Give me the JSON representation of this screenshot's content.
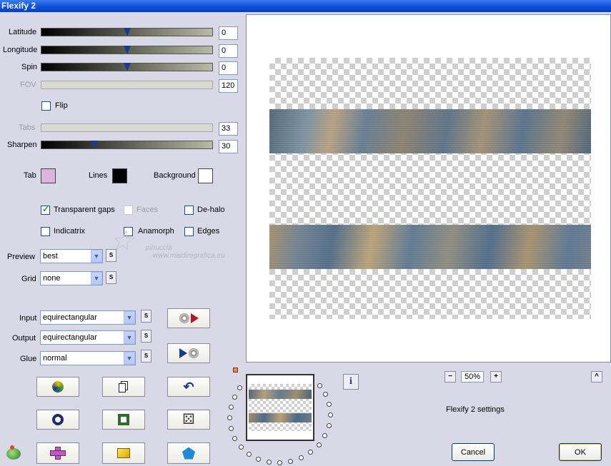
{
  "window": {
    "title": "Flexify 2"
  },
  "sliders": [
    {
      "label": "Latitude",
      "value": "0",
      "fraction": 0.5,
      "enabled": true
    },
    {
      "label": "Longitude",
      "value": "0",
      "fraction": 0.5,
      "enabled": true
    },
    {
      "label": "Spin",
      "value": "0",
      "fraction": 0.5,
      "enabled": true
    },
    {
      "label": "FOV",
      "value": "120",
      "fraction": null,
      "enabled": false
    },
    {
      "label": "Tabs",
      "value": "33",
      "fraction": null,
      "enabled": false
    },
    {
      "label": "Sharpen",
      "value": "30",
      "fraction": 0.3,
      "enabled": true
    }
  ],
  "flip": {
    "label": "Flip",
    "checked": false
  },
  "colors": {
    "tab": {
      "label": "Tab",
      "color": "#dcb4dc"
    },
    "lines": {
      "label": "Lines",
      "color": "#000000"
    },
    "background": {
      "label": "Background",
      "color": "#ffffff"
    }
  },
  "options": {
    "transparent_gaps": {
      "label": "Transparent gaps",
      "checked": true
    },
    "faces": {
      "label": "Faces",
      "checked": false,
      "enabled": false
    },
    "de_halo": {
      "label": "De-halo",
      "checked": false
    },
    "indicatrix": {
      "label": "Indicatrix",
      "checked": false
    },
    "anamorph": {
      "label": "Anamorph",
      "checked": false
    },
    "edges": {
      "label": "Edges",
      "checked": false
    }
  },
  "preview_select": {
    "label": "Preview",
    "value": "best"
  },
  "grid_select": {
    "label": "Grid",
    "value": "none"
  },
  "input_select": {
    "label": "Input",
    "value": "equirectangular"
  },
  "output_select": {
    "label": "Output",
    "value": "equirectangular"
  },
  "glue_select": {
    "label": "Glue",
    "value": "normal"
  },
  "s_button": "S",
  "watermark": {
    "name": "pinuccia",
    "url": "www.maidiregrafica.eu"
  },
  "zoom": {
    "value": "50%",
    "minus": "−",
    "plus": "+"
  },
  "info_label": "i",
  "collapse_label": "^",
  "status": "Flexify 2 settings",
  "buttons": {
    "cancel": "Cancel",
    "ok": "OK"
  },
  "accent": "#0a4ed8"
}
